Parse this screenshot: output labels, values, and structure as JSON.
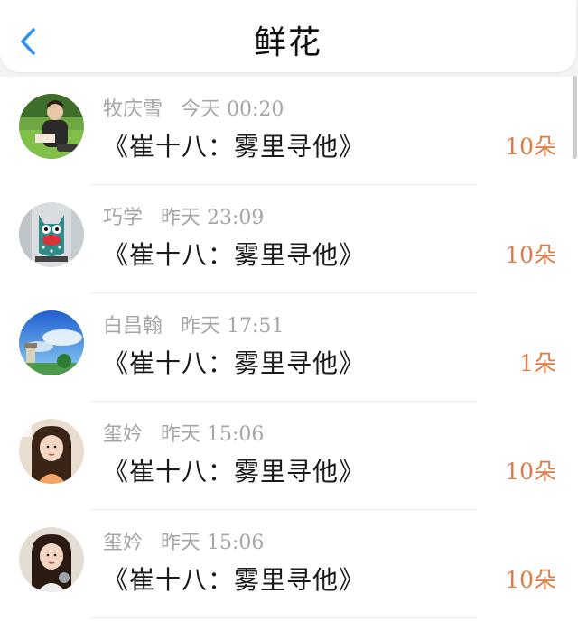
{
  "header": {
    "title": "鲜花",
    "back_icon": "chevron-left-icon",
    "accent": "#2b8ff0"
  },
  "colors": {
    "count": "#e07a45",
    "meta": "#a6a6a6"
  },
  "items": [
    {
      "user": "牧庆雪",
      "time": "今天 00:20",
      "book": "《崔十八：雾里寻他》",
      "count": "10朵",
      "avatar": "avatar-man-reading"
    },
    {
      "user": "巧学",
      "time": "昨天 23:09",
      "book": "《崔十八：雾里寻他》",
      "count": "10朵",
      "avatar": "avatar-plush-monster"
    },
    {
      "user": "白昌翰",
      "time": "昨天 17:51",
      "book": "《崔十八：雾里寻他》",
      "count": "1朵",
      "avatar": "avatar-sky-scene"
    },
    {
      "user": "玺妗",
      "time": "昨天 15:06",
      "book": "《崔十八：雾里寻他》",
      "count": "10朵",
      "avatar": "avatar-girl"
    },
    {
      "user": "玺妗",
      "time": "昨天 15:06",
      "book": "《崔十八：雾里寻他》",
      "count": "10朵",
      "avatar": "avatar-girl"
    }
  ]
}
